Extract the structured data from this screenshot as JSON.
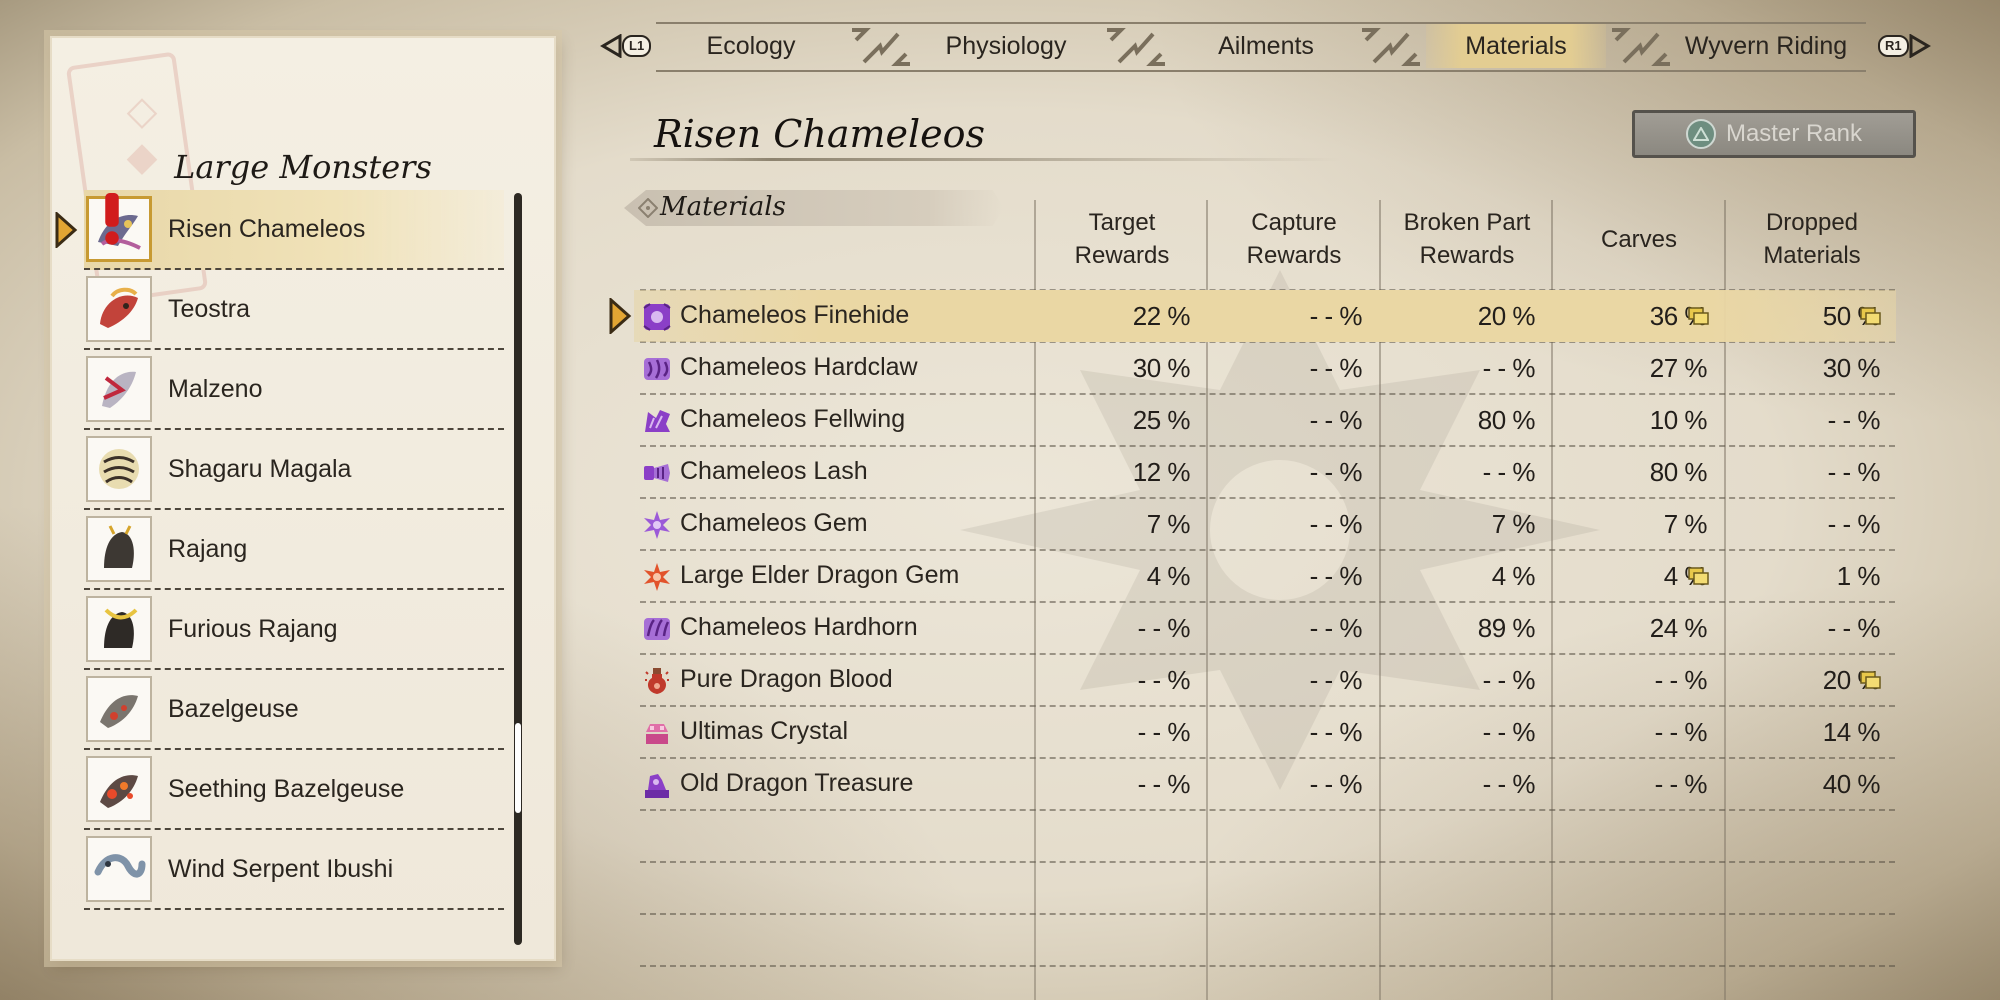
{
  "tabs": {
    "left_button": "L1",
    "right_button": "R1",
    "items": [
      {
        "label": "Ecology",
        "active": false
      },
      {
        "label": "Physiology",
        "active": false
      },
      {
        "label": "Ailments",
        "active": false
      },
      {
        "label": "Materials",
        "active": true
      },
      {
        "label": "Wyvern Riding",
        "active": false
      }
    ]
  },
  "sidebar": {
    "title": "Large Monsters",
    "items": [
      {
        "label": "Risen Chameleos",
        "icon": "risen-chameleos-icon",
        "selected": true,
        "alert": true
      },
      {
        "label": "Teostra",
        "icon": "teostra-icon"
      },
      {
        "label": "Malzeno",
        "icon": "malzeno-icon"
      },
      {
        "label": "Shagaru Magala",
        "icon": "shagaru-magala-icon"
      },
      {
        "label": "Rajang",
        "icon": "rajang-icon"
      },
      {
        "label": "Furious Rajang",
        "icon": "furious-rajang-icon"
      },
      {
        "label": "Bazelgeuse",
        "icon": "bazelgeuse-icon"
      },
      {
        "label": "Seething Bazelgeuse",
        "icon": "seething-bazelgeuse-icon"
      },
      {
        "label": "Wind Serpent Ibushi",
        "icon": "wind-serpent-ibushi-icon"
      }
    ]
  },
  "header": {
    "monster_name": "Risen Chameleos",
    "rank_button_label": "Master Rank",
    "rank_button_glyph": "triangle-button-icon"
  },
  "table": {
    "section_label": "Materials",
    "columns": [
      "Target\nRewards",
      "Capture\nRewards",
      "Broken Part\nRewards",
      "Carves",
      "Dropped\nMaterials"
    ],
    "rows": [
      {
        "name": "Chameleos Finehide",
        "icon": "hide-icon",
        "icon_color": "#8b3fc7",
        "selected": true,
        "values": [
          "22 %",
          "- - %",
          "20 %",
          "36 %",
          "50 %"
        ],
        "notes": [
          false,
          false,
          false,
          true,
          true
        ]
      },
      {
        "name": "Chameleos Hardclaw",
        "icon": "claw-icon",
        "icon_color": "#8b3fc7",
        "values": [
          "30 %",
          "- - %",
          "- - %",
          "27 %",
          "30 %"
        ],
        "notes": [
          false,
          false,
          false,
          false,
          false
        ]
      },
      {
        "name": "Chameleos Fellwing",
        "icon": "wing-icon",
        "icon_color": "#8b3fc7",
        "values": [
          "25 %",
          "- - %",
          "80 %",
          "10 %",
          "- - %"
        ],
        "notes": [
          false,
          false,
          false,
          false,
          false
        ]
      },
      {
        "name": "Chameleos Lash",
        "icon": "tail-icon",
        "icon_color": "#8b3fc7",
        "values": [
          "12 %",
          "- - %",
          "- - %",
          "80 %",
          "- - %"
        ],
        "notes": [
          false,
          false,
          false,
          false,
          false
        ]
      },
      {
        "name": "Chameleos Gem",
        "icon": "gem-icon",
        "icon_color": "#8b3fc7",
        "values": [
          "7 %",
          "- - %",
          "7 %",
          "7 %",
          "- - %"
        ],
        "notes": [
          false,
          false,
          false,
          false,
          false
        ]
      },
      {
        "name": "Large Elder Dragon Gem",
        "icon": "elder-gem-icon",
        "icon_color": "#e2532b",
        "values": [
          "4 %",
          "- - %",
          "4 %",
          "4 %",
          "1 %"
        ],
        "notes": [
          false,
          false,
          false,
          true,
          false
        ]
      },
      {
        "name": "Chameleos Hardhorn",
        "icon": "horn-icon",
        "icon_color": "#8b3fc7",
        "values": [
          "- - %",
          "- - %",
          "89 %",
          "24 %",
          "- - %"
        ],
        "notes": [
          false,
          false,
          false,
          false,
          false
        ]
      },
      {
        "name": "Pure Dragon Blood",
        "icon": "blood-flask-icon",
        "icon_color": "#c0392b",
        "values": [
          "- - %",
          "- - %",
          "- - %",
          "- - %",
          "20 %"
        ],
        "notes": [
          false,
          false,
          false,
          false,
          true
        ]
      },
      {
        "name": "Ultimas Crystal",
        "icon": "crystal-icon",
        "icon_color": "#e06fa8",
        "values": [
          "- - %",
          "- - %",
          "- - %",
          "- - %",
          "14 %"
        ],
        "notes": [
          false,
          false,
          false,
          false,
          false
        ]
      },
      {
        "name": "Old Dragon Treasure",
        "icon": "treasure-icon",
        "icon_color": "#8b3fc7",
        "values": [
          "- - %",
          "- - %",
          "- - %",
          "- - %",
          "40 %"
        ],
        "notes": [
          false,
          false,
          false,
          false,
          false
        ]
      }
    ]
  }
}
